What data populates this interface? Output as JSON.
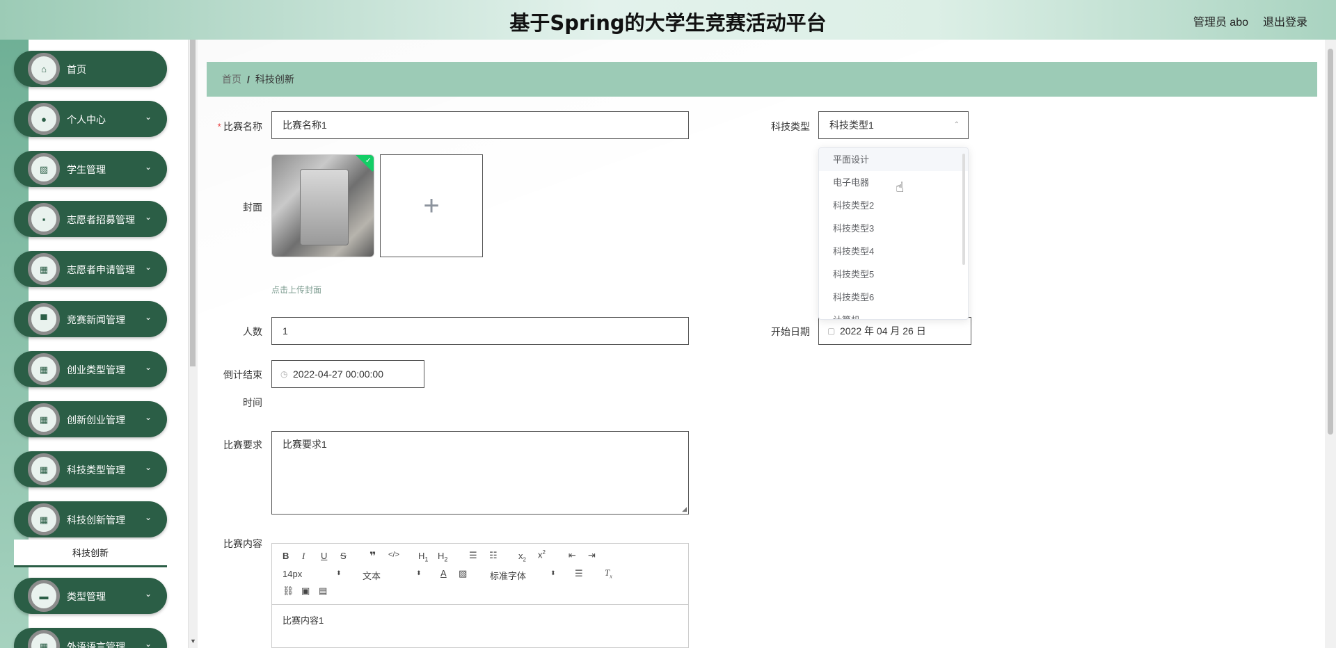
{
  "header": {
    "title": "基于Spring的大学生竞赛活动平台",
    "user": "管理员 abo",
    "logout": "退出登录"
  },
  "sidebar": {
    "items": [
      {
        "label": "首页",
        "icon": "home-icon",
        "glyph": "⌂",
        "has_chevron": false
      },
      {
        "label": "个人中心",
        "icon": "user-icon",
        "glyph": "●",
        "has_chevron": true
      },
      {
        "label": "学生管理",
        "icon": "chart-icon",
        "glyph": "▨",
        "has_chevron": true
      },
      {
        "label": "志愿者招募管理",
        "icon": "chat-icon",
        "glyph": "▪",
        "has_chevron": true
      },
      {
        "label": "志愿者申请管理",
        "icon": "grid-icon",
        "glyph": "▦",
        "has_chevron": true
      },
      {
        "label": "竞赛新闻管理",
        "icon": "monitor-icon",
        "glyph": "▀",
        "has_chevron": true
      },
      {
        "label": "创业类型管理",
        "icon": "grid-icon",
        "glyph": "▦",
        "has_chevron": true
      },
      {
        "label": "创新创业管理",
        "icon": "grid-icon",
        "glyph": "▦",
        "has_chevron": true
      },
      {
        "label": "科技类型管理",
        "icon": "grid-icon",
        "glyph": "▦",
        "has_chevron": true
      },
      {
        "label": "科技创新管理",
        "icon": "grid-icon",
        "glyph": "▦",
        "has_chevron": true
      },
      {
        "label": "类型管理",
        "icon": "cart-icon",
        "glyph": "▬",
        "has_chevron": true
      },
      {
        "label": "外语语言管理",
        "icon": "grid-icon",
        "glyph": "▦",
        "has_chevron": true
      }
    ],
    "submenu_active": "科技创新"
  },
  "breadcrumb": {
    "home": "首页",
    "separator": "/",
    "current": "科技创新"
  },
  "form": {
    "name_label": "比赛名称",
    "name_value": "比赛名称1",
    "type_label": "科技类型",
    "type_value": "科技类型1",
    "cover_label": "封面",
    "cover_hint": "点击上传封面",
    "count_label": "人数",
    "count_value": "1",
    "start_label": "开始日期",
    "start_value": "2022 年 04 月 26 日",
    "countdown_label_1": "倒计结束",
    "countdown_label_2": "时间",
    "countdown_value": "2022-04-27 00:00:00",
    "req_label": "比赛要求",
    "req_value": "比赛要求1",
    "content_label": "比赛内容",
    "content_value": "比赛内容1"
  },
  "dropdown": {
    "options": [
      "平面设计",
      "电子电器",
      "科技类型2",
      "科技类型3",
      "科技类型4",
      "科技类型5",
      "科技类型6",
      "计算机"
    ]
  },
  "editor": {
    "font_size": "14px",
    "block_format": "文本",
    "font_family": "标准字体"
  },
  "colors": {
    "primary": "#2b5e46",
    "breadcrumb_bg": "#9ccbb6",
    "required": "#e94848"
  }
}
